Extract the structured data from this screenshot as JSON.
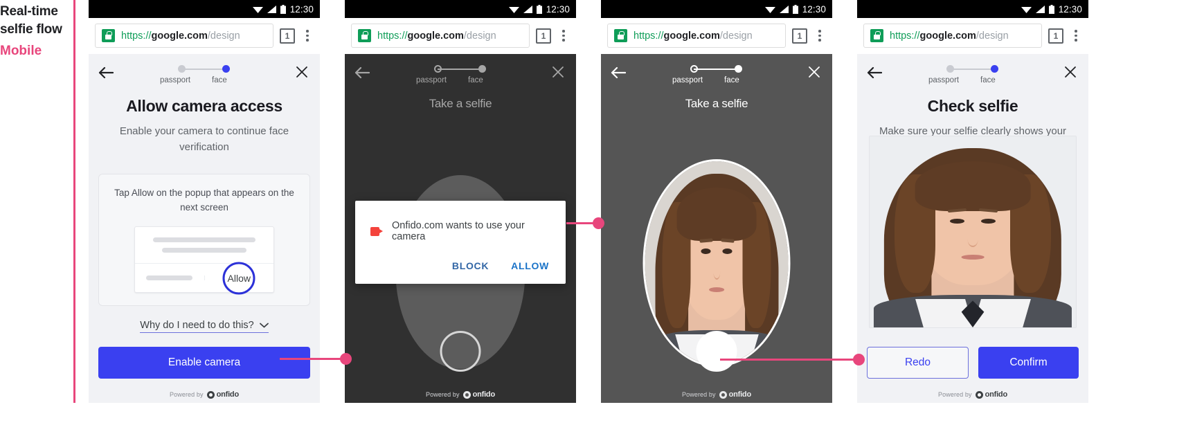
{
  "annotation": {
    "line1": "Real-time",
    "line2": "selfie flow",
    "platform": "Mobile",
    "accent_color": "#e8467c"
  },
  "browser": {
    "status_time": "12:30",
    "url_scheme": "https://",
    "url_host": "google.com",
    "url_path": "/design",
    "tab_count": "1",
    "lock_icon": "secure-lock-icon",
    "menu_icon": "kebab-menu-icon"
  },
  "stepper": {
    "step1": "passport",
    "step2": "face",
    "active": "face",
    "active_color": "#3a40f0"
  },
  "footer": {
    "powered_by": "Powered by",
    "brand": "onfido"
  },
  "panels": [
    {
      "id": "allow-camera-access",
      "title": "Allow camera access",
      "subtitle": "Enable your camera to continue face verification",
      "card_tip": "Tap Allow on the popup that appears on the next screen",
      "mock_allow_label": "Allow",
      "why_link": "Why do I need to do this?",
      "primary_button": "Enable camera"
    },
    {
      "id": "camera-permission-prompt",
      "title": "Take a selfie",
      "dialog_text": "Onfido.com wants to use your camera",
      "dialog_icon": "camera-icon",
      "block_label": "BLOCK",
      "allow_label": "ALLOW"
    },
    {
      "id": "take-a-selfie",
      "title": "Take a selfie",
      "shutter": "shutter-button"
    },
    {
      "id": "check-selfie",
      "title": "Check selfie",
      "subtitle": "Make sure your selfie clearly shows your face",
      "redo_label": "Redo",
      "confirm_label": "Confirm"
    }
  ]
}
